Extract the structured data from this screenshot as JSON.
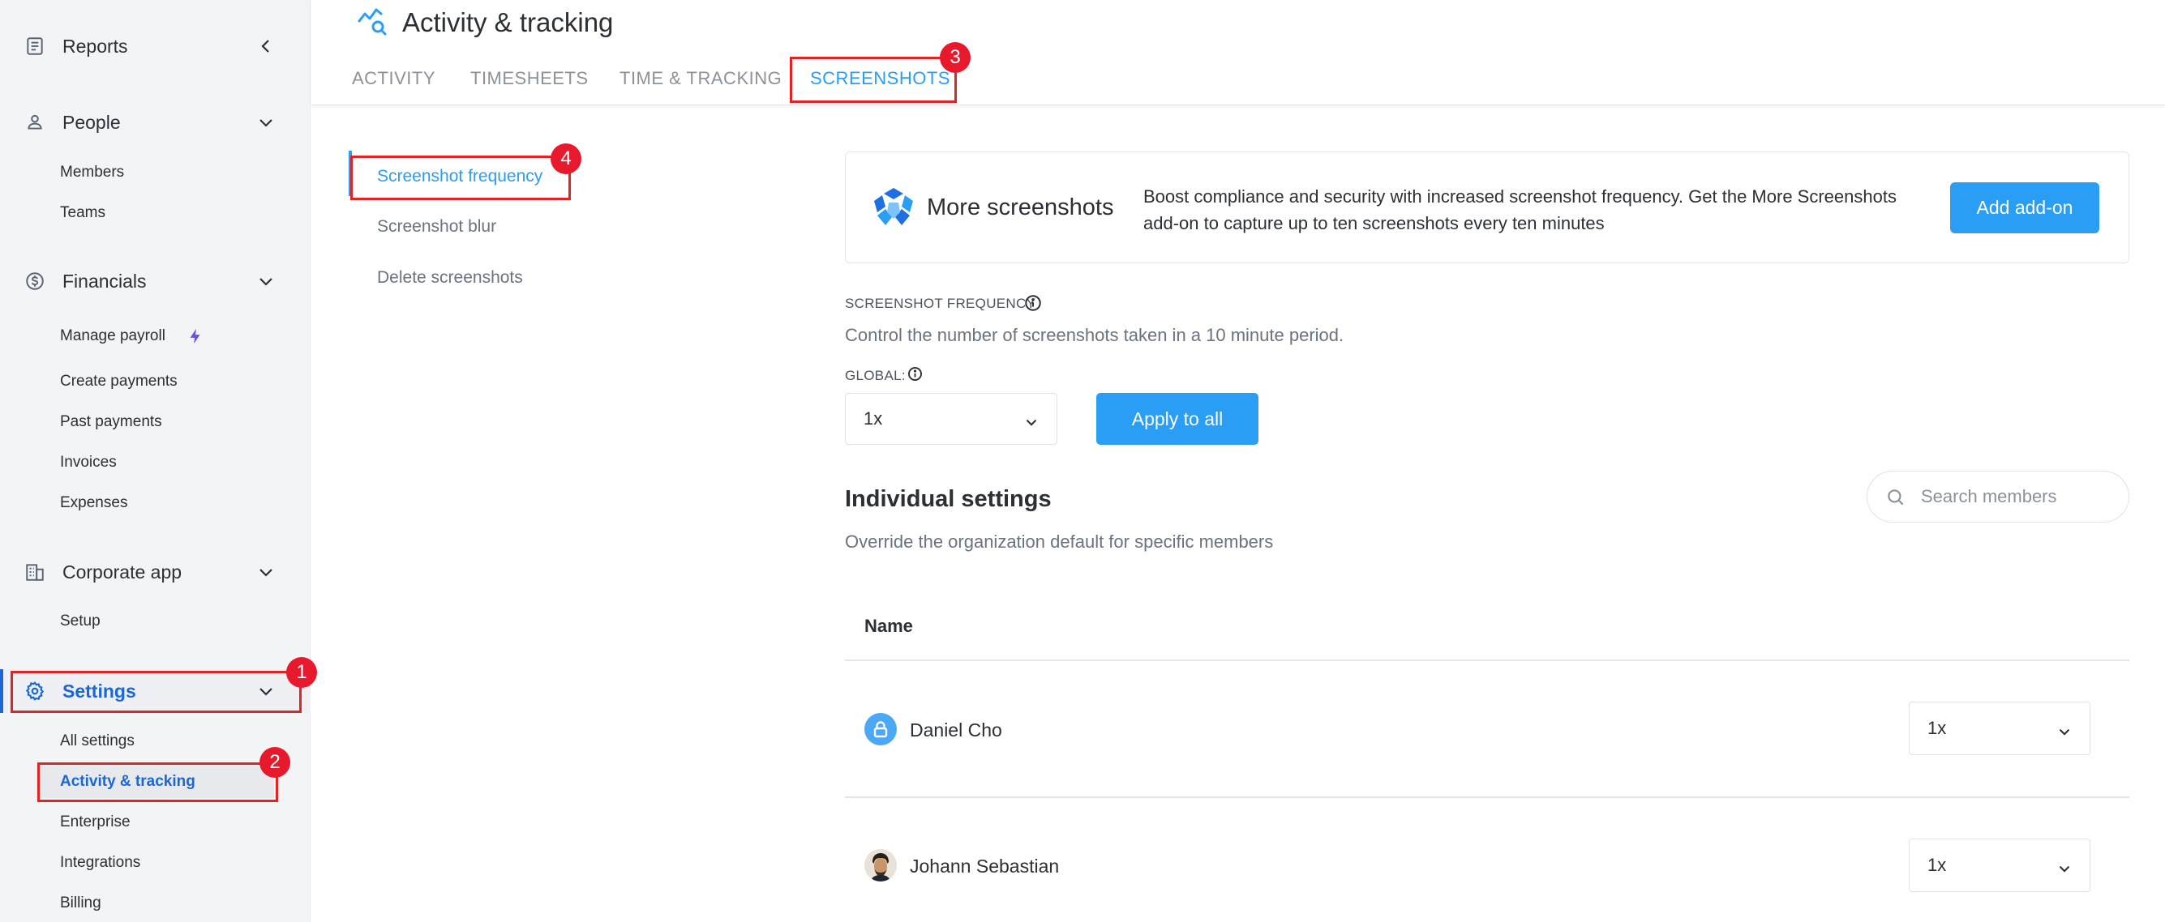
{
  "sidebar": {
    "reports": {
      "label": "Reports"
    },
    "people": {
      "label": "People",
      "items": [
        "Members",
        "Teams"
      ]
    },
    "financials": {
      "label": "Financials",
      "items": [
        "Manage payroll",
        "Create payments",
        "Past payments",
        "Invoices",
        "Expenses"
      ]
    },
    "corporate": {
      "label": "Corporate app",
      "items": [
        "Setup"
      ]
    },
    "settings": {
      "label": "Settings",
      "items": [
        "All settings",
        "Activity & tracking",
        "Enterprise",
        "Integrations",
        "Billing"
      ]
    }
  },
  "header": {
    "title": "Activity & tracking",
    "tabs": [
      "ACTIVITY",
      "TIMESHEETS",
      "TIME & TRACKING",
      "SCREENSHOTS"
    ]
  },
  "subnav": [
    "Screenshot frequency",
    "Screenshot blur",
    "Delete screenshots"
  ],
  "banner": {
    "title": "More screenshots",
    "description": "Boost compliance and security with increased screenshot frequency. Get the More Screenshots add-on to capture up to ten screenshots every ten minutes",
    "button": "Add add-on"
  },
  "frequency": {
    "label": "SCREENSHOT FREQUENCY",
    "help": "Control the number of screenshots taken in a 10 minute period.",
    "global_label": "GLOBAL:",
    "global_value": "1x",
    "apply_button": "Apply to all"
  },
  "individual": {
    "title": "Individual settings",
    "description": "Override the organization default for specific members",
    "search_placeholder": "Search members",
    "column_name": "Name",
    "members": [
      {
        "name": "Daniel Cho",
        "value": "1x"
      },
      {
        "name": "Johann Sebastian",
        "value": "1x"
      }
    ]
  },
  "annotations": [
    "1",
    "2",
    "3",
    "4"
  ],
  "colors": {
    "accent": "#2a9df4",
    "settings_active": "#1b67d6",
    "annotation": "#e02424"
  }
}
